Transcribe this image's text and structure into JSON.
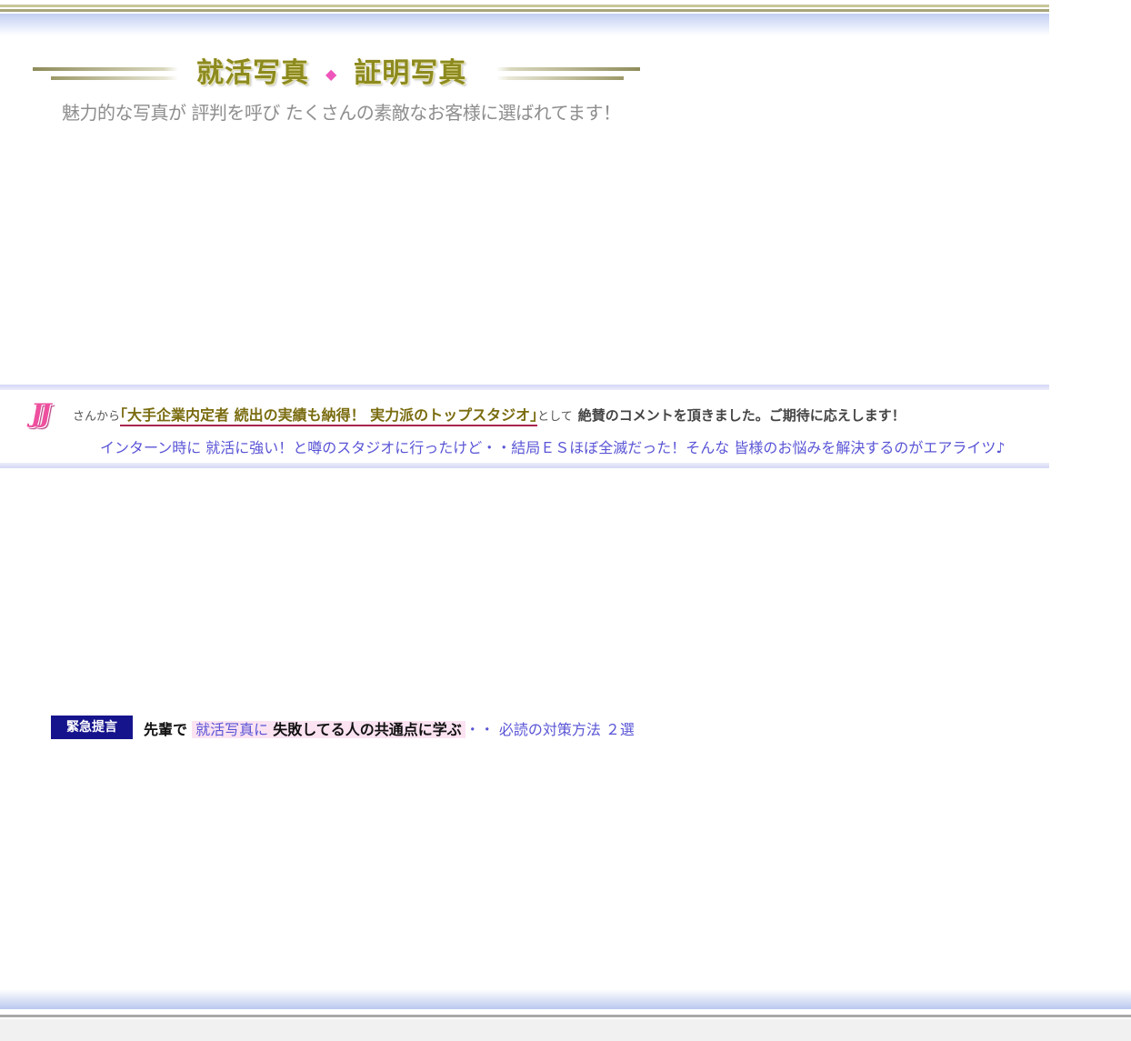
{
  "header": {
    "title_part1": "就活写真",
    "title_separator": "◆",
    "title_part2": "証明写真",
    "subtitle": "魅力的な写真が 評判を呼び たくさんの素敵なお客様に選ばれてます！"
  },
  "testimonial": {
    "logo_text": "JJ",
    "prefix": "さんから",
    "quote": "｢大手企業内定者 続出の実績も納得！ 実力派のトップスタジオ｣",
    "suffix": "として",
    "praise": "絶賛のコメントを頂きました。ご期待に応えします！",
    "line2": "インターン時に 就活に強い！と噂のスタジオに行ったけど・・結局ＥＳほぼ全滅だった！そんな 皆様のお悩みを解決するのがエアライツ♪"
  },
  "urgent": {
    "badge": "緊急提言",
    "lead": "先輩で",
    "highlight_blue": "就活写真に",
    "highlight_rest": "失敗してる人の共通点に学ぶ",
    "trail": "・・ 必読の対策方法 ２選"
  },
  "colors": {
    "title": "#8d8a1f",
    "accent_pink": "#ee55bb",
    "link_blue": "#5a55d6",
    "badge_bg": "#16148c",
    "quote_underline": "#a8254e"
  }
}
